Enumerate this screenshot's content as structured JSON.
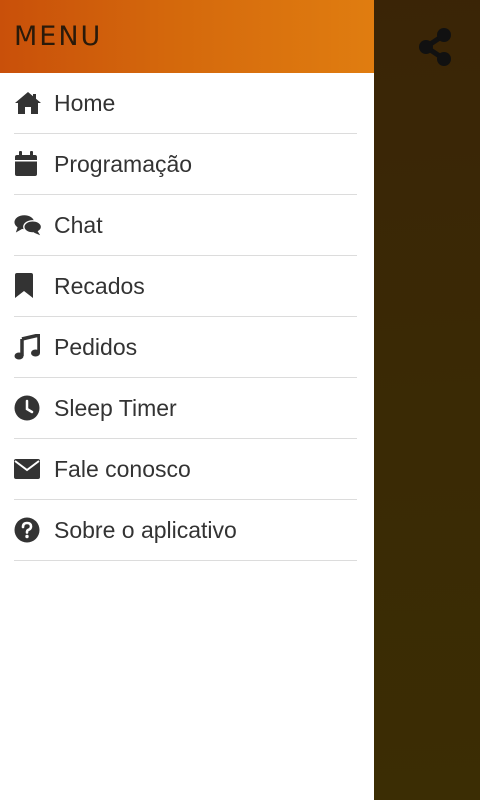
{
  "drawer": {
    "title": "MENU",
    "items": [
      {
        "label": "Home",
        "icon": "home-icon"
      },
      {
        "label": "Programação",
        "icon": "calendar-icon"
      },
      {
        "label": "Chat",
        "icon": "chat-bubbles-icon"
      },
      {
        "label": "Recados",
        "icon": "bookmark-icon"
      },
      {
        "label": "Pedidos",
        "icon": "music-note-icon"
      },
      {
        "label": "Sleep Timer",
        "icon": "clock-icon"
      },
      {
        "label": "Fale conosco",
        "icon": "envelope-icon"
      },
      {
        "label": "Sobre o aplicativo",
        "icon": "question-circle-icon"
      }
    ]
  },
  "header_action": {
    "icon": "share-icon"
  },
  "colors": {
    "header_start": "#c9500a",
    "header_end": "#e07d10",
    "backdrop": "#3a2a05",
    "icon": "#333333",
    "divider": "#dcdcdc"
  }
}
